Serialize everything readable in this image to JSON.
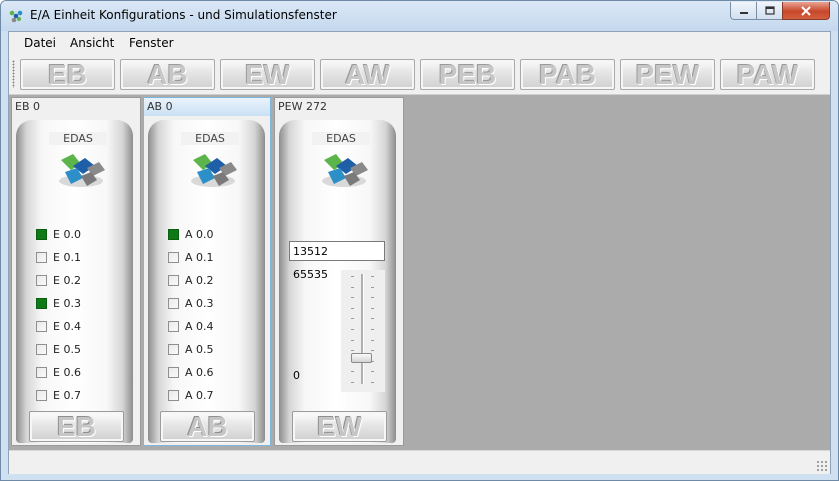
{
  "window": {
    "title": "E/A Einheit Konfigurations - und Simulationsfenster",
    "app_icon": "network-icon"
  },
  "menu": [
    {
      "label": "Datei"
    },
    {
      "label": "Ansicht"
    },
    {
      "label": "Fenster"
    }
  ],
  "toolbar": [
    {
      "label": "EB"
    },
    {
      "label": "AB"
    },
    {
      "label": "EW"
    },
    {
      "label": "AW"
    },
    {
      "label": "PEB"
    },
    {
      "label": "PAB"
    },
    {
      "label": "PEW"
    },
    {
      "label": "PAW"
    }
  ],
  "modules": {
    "eb": {
      "header": "EB 0",
      "logo_text": "EDAS",
      "button": "EB",
      "items": [
        {
          "label": "E 0.0",
          "checked": true
        },
        {
          "label": "E 0.1",
          "checked": false
        },
        {
          "label": "E 0.2",
          "checked": false
        },
        {
          "label": "E 0.3",
          "checked": true
        },
        {
          "label": "E 0.4",
          "checked": false
        },
        {
          "label": "E 0.5",
          "checked": false
        },
        {
          "label": "E 0.6",
          "checked": false
        },
        {
          "label": "E 0.7",
          "checked": false
        }
      ]
    },
    "ab": {
      "header": "AB 0",
      "logo_text": "EDAS",
      "button": "AB",
      "items": [
        {
          "label": "A 0.0",
          "checked": true
        },
        {
          "label": "A 0.1",
          "checked": false
        },
        {
          "label": "A 0.2",
          "checked": false
        },
        {
          "label": "A 0.3",
          "checked": false
        },
        {
          "label": "A 0.4",
          "checked": false
        },
        {
          "label": "A 0.5",
          "checked": false
        },
        {
          "label": "A 0.6",
          "checked": false
        },
        {
          "label": "A 0.7",
          "checked": false
        }
      ]
    },
    "pew": {
      "header": "PEW 272",
      "logo_text": "EDAS",
      "button": "EW",
      "value": "13512",
      "max_label": "65535",
      "min_label": "0",
      "slider_fraction": 0.206
    }
  },
  "colors": {
    "checked": "#0e7a16",
    "workspace": "#ababab",
    "logo_green": "#5bb54a",
    "logo_blue": "#1f5fa8",
    "logo_grey": "#8a8a8a"
  }
}
